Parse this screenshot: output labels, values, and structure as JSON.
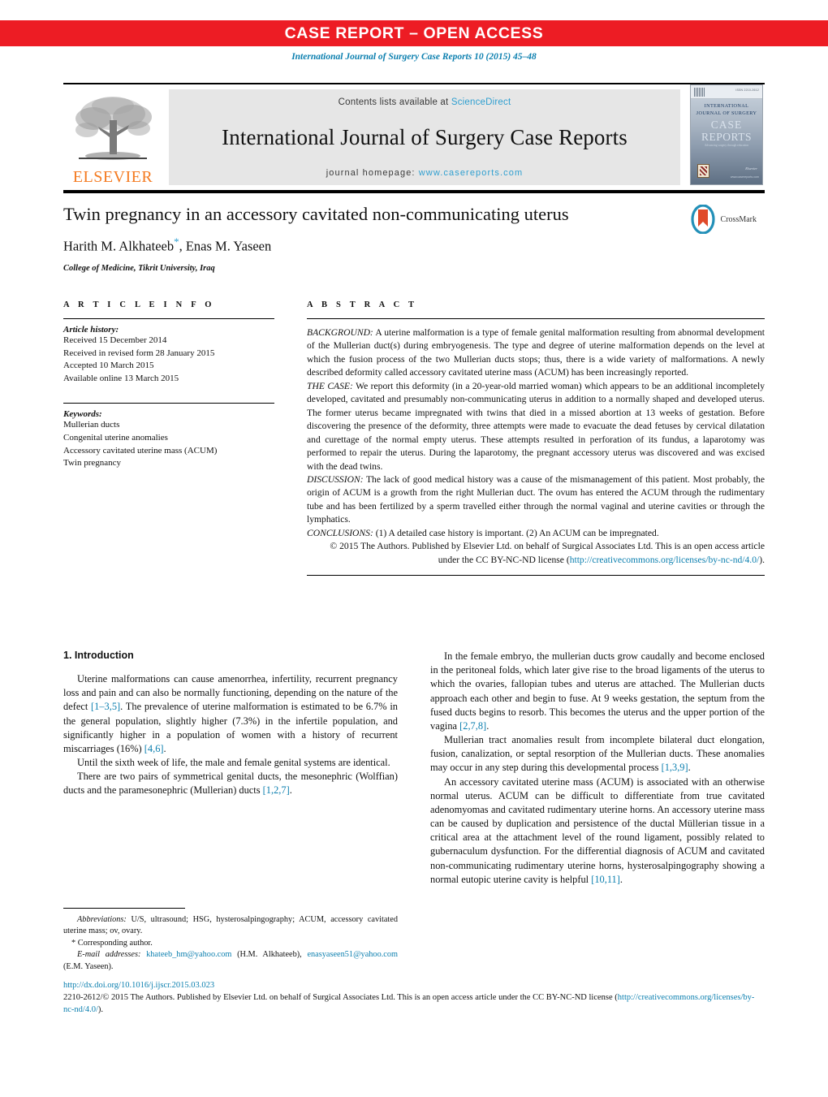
{
  "banner": {
    "label": "CASE REPORT – OPEN ACCESS",
    "color": "#ed1c24"
  },
  "journal_ref": "International Journal of Surgery Case Reports 10 (2015) 45–48",
  "masthead": {
    "publisher": "ELSEVIER",
    "contents_prefix": "Contents lists available at ",
    "contents_link": "ScienceDirect",
    "journal_title": "International Journal of Surgery Case Reports",
    "homepage_prefix": "journal homepage: ",
    "homepage_url": "www.casereports.com",
    "link_color": "#2f9fd0",
    "cover": {
      "line1": "INTERNATIONAL",
      "line2": "JOURNAL OF SURGERY",
      "word_case": "CASE",
      "word_reports": "REPORTS",
      "subtitle": "Advancing surgery through education",
      "issn": "ISSN 2210-2612",
      "publisher_mark": "Elsevier",
      "url": "www.casereports.com"
    }
  },
  "article": {
    "title": "Twin pregnancy in an accessory cavitated non-communicating uterus",
    "authors": "Harith M. Alkhateeb",
    "authors_rest": ", Enas M. Yaseen",
    "corresponding_marker": "*",
    "affiliation": "College of Medicine, Tikrit University, Iraq",
    "crossmark_label": "CrossMark"
  },
  "article_info": {
    "heading": "A R T I C L E   I N F O",
    "history_label": "Article history:",
    "history": [
      "Received 15 December 2014",
      "Received in revised form 28 January 2015",
      "Accepted 10 March 2015",
      "Available online 13 March 2015"
    ],
    "keywords_label": "Keywords:",
    "keywords": [
      "Mullerian ducts",
      "Congenital uterine anomalies",
      "Accessory cavitated uterine mass (ACUM)",
      "Twin pregnancy"
    ]
  },
  "abstract": {
    "heading": "A B S T R A C T",
    "background_label": "BACKGROUND:",
    "background_text": " A uterine malformation is a type of female genital malformation resulting from abnormal development of the Mullerian duct(s) during embryogenesis. The type and degree of uterine malformation depends on the level at which the fusion process of the two Mullerian ducts stops; thus, there is a wide variety of malformations. A newly described deformity called accessory cavitated uterine mass (ACUM) has been increasingly reported.",
    "case_label": "THE CASE:",
    "case_text": " We report this deformity (in a 20-year-old married woman) which appears to be an additional incompletely developed, cavitated and presumably non-communicating uterus in addition to a normally shaped and developed uterus. The former uterus became impregnated with twins that died in a missed abortion at 13 weeks of gestation. Before discovering the presence of the deformity, three attempts were made to evacuate the dead fetuses by cervical dilatation and curettage of the normal empty uterus. These attempts resulted in perforation of its fundus, a laparotomy was performed to repair the uterus. During the laparotomy, the pregnant accessory uterus was discovered and was excised with the dead twins.",
    "discussion_label": "DISCUSSION:",
    "discussion_text": " The lack of good medical history was a cause of the mismanagement of this patient. Most probably, the origin of ACUM is a growth from the right Mullerian duct. The ovum has entered the ACUM through the rudimentary tube and has been fertilized by a sperm travelled either through the normal vaginal and uterine cavities or through the lymphatics.",
    "conclusions_label": "CONCLUSIONS:",
    "conclusions_text": " (1) A detailed case history is important. (2) An ACUM can be impregnated.",
    "copyright_text": "© 2015 The Authors. Published by Elsevier Ltd. on behalf of Surgical Associates Ltd. This is an open access article under the CC BY-NC-ND license (",
    "copyright_link": "http://creativecommons.org/licenses/by-nc-nd/4.0/",
    "copyright_tail": ")."
  },
  "introduction": {
    "heading": "1.  Introduction",
    "left_paragraphs": [
      {
        "parts": [
          {
            "t": "Uterine malformations can cause amenorrhea, infertility, recurrent pregnancy loss and pain and can also be normally functioning, depending on the nature of the defect "
          },
          {
            "t": "[1–3,5]",
            "ref": true
          },
          {
            "t": ". The prevalence of uterine malformation is estimated to be 6.7% in the general population, slightly higher (7.3%) in the infertile population, and significantly higher in a population of women with a history of recurrent miscarriages (16%) "
          },
          {
            "t": "[4,6]",
            "ref": true
          },
          {
            "t": "."
          }
        ]
      },
      {
        "parts": [
          {
            "t": "Until the sixth week of life, the male and female genital systems are identical."
          }
        ]
      },
      {
        "parts": [
          {
            "t": "There are two pairs of symmetrical genital ducts, the mesonephric (Wolffian) ducts and the paramesonephric (Mullerian) ducts "
          },
          {
            "t": "[1,2,7]",
            "ref": true
          },
          {
            "t": "."
          }
        ]
      }
    ],
    "right_paragraphs": [
      {
        "parts": [
          {
            "t": "In the female embryo, the mullerian ducts grow caudally and become enclosed in the peritoneal folds, which later give rise to the broad ligaments of the uterus to which the ovaries, fallopian tubes and uterus are attached. The Mullerian ducts approach each other and begin to fuse. At 9 weeks gestation, the septum from the fused ducts begins to resorb. This becomes the uterus and the upper portion of the vagina "
          },
          {
            "t": "[2,7,8]",
            "ref": true
          },
          {
            "t": "."
          }
        ]
      },
      {
        "parts": [
          {
            "t": "Mullerian tract anomalies result from incomplete bilateral duct elongation, fusion, canalization, or septal resorption of the Mullerian ducts. These anomalies may occur in any step during this developmental process "
          },
          {
            "t": "[1,3,9]",
            "ref": true
          },
          {
            "t": "."
          }
        ]
      },
      {
        "parts": [
          {
            "t": "An accessory cavitated uterine mass (ACUM) is associated with an otherwise normal uterus. ACUM can be difficult to differentiate from true cavitated adenomyomas and cavitated rudimentary uterine horns. An accessory uterine mass can be caused by duplication and persistence of the ductal Müllerian tissue in a critical area at the attachment level of the round ligament, possibly related to gubernaculum dysfunction. For the differential diagnosis of ACUM and cavitated non-communicating rudimentary uterine horns, hysterosalpingography showing a normal eutopic uterine cavity is helpful "
          },
          {
            "t": "[10,11]",
            "ref": true
          },
          {
            "t": "."
          }
        ]
      }
    ]
  },
  "footnotes": {
    "abbrev_label": "Abbreviations:",
    "abbrev_text": "  U/S, ultrasound; HSG, hysterosalpingography; ACUM, accessory cavitated uterine mass; ov, ovary.",
    "corresponding": "* Corresponding author.",
    "email_label": "E-mail addresses:",
    "email1": "khateeb_hm@yahoo.com",
    "email1_owner": " (H.M. Alkhateeb),",
    "email2": "enasyaseen51@yahoo.com",
    "email2_owner": " (E.M. Yaseen)."
  },
  "bottom": {
    "doi": "http://dx.doi.org/10.1016/j.ijscr.2015.03.023",
    "license_prefix": "2210-2612/© 2015 The Authors. Published by Elsevier Ltd. on behalf of Surgical Associates Ltd. This is an open access article under the CC BY-NC-ND license (",
    "license_link1": "http://",
    "license_link2": "creativecommons.org/licenses/by-nc-nd/4.0/",
    "license_tail": ")."
  }
}
